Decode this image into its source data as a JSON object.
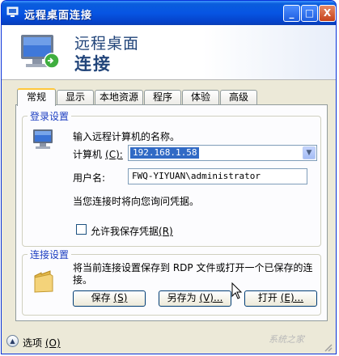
{
  "window": {
    "title": "远程桌面连接",
    "min_label": "_",
    "max_label": "□",
    "close_label": "X"
  },
  "banner": {
    "line1": "远程桌面",
    "line2": "连接"
  },
  "tabs": [
    {
      "label": "常规",
      "active": true
    },
    {
      "label": "显示"
    },
    {
      "label": "本地资源"
    },
    {
      "label": "程序"
    },
    {
      "label": "体验"
    },
    {
      "label": "高级"
    }
  ],
  "login": {
    "group_title": "登录设置",
    "prompt": "输入远程计算机的名称。",
    "computer_label": "计算机",
    "computer_accel": "(C):",
    "computer_value": "192.168.1.58",
    "user_label": "用户名:",
    "user_value": "FWQ-YIYUAN\\administrator",
    "note": "当您连接时将向您询问凭据。",
    "save_creds_label": "允许我保存凭据",
    "save_creds_accel": "(R)"
  },
  "connection": {
    "group_title": "连接设置",
    "description_line1": "将当前连接设置保存到 RDP 文件或打开一个已保存的连",
    "description_line2": "接。",
    "save_label": "保存",
    "save_accel": "(S)",
    "save_as_label": "另存为",
    "save_as_accel": "(V)...",
    "open_label": "打开",
    "open_accel": "(E)..."
  },
  "footer": {
    "options_label": "选项",
    "options_accel": "(O)"
  },
  "watermark": "系统之家"
}
